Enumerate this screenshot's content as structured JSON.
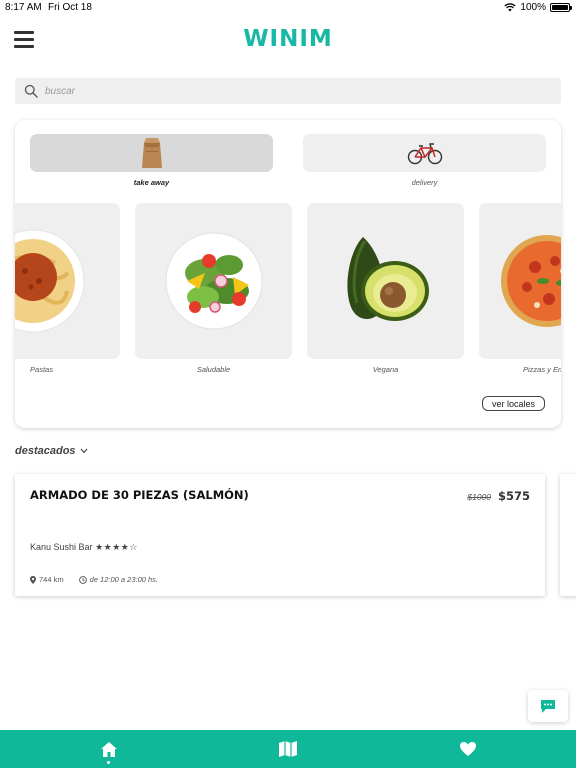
{
  "status_bar": {
    "time": "8:17 AM",
    "date": "Fri Oct 18",
    "battery": "100%"
  },
  "header": {
    "logo": "WINIM"
  },
  "search": {
    "placeholder": "buscar"
  },
  "modes": [
    {
      "label": "take away",
      "icon": "paper-bag-icon",
      "selected": true
    },
    {
      "label": "delivery",
      "icon": "bicycle-icon",
      "selected": false
    }
  ],
  "categories": [
    {
      "label": "Pastas",
      "icon": "pasta-plate-icon"
    },
    {
      "label": "Saludable",
      "icon": "salad-bowl-icon"
    },
    {
      "label": "Vegana",
      "icon": "avocado-icon"
    },
    {
      "label": "Pizzas y Em",
      "icon": "pizza-icon"
    }
  ],
  "ver_locales": "ver locales",
  "featured": {
    "title": "destacados",
    "deal": {
      "name": "ARMADO DE 30 PIEZAS (SALMÓN)",
      "old_price": "$1000",
      "price": "$575",
      "store": "Kanu Sushi Bar",
      "rating": "★★★★☆",
      "distance": "744 km",
      "hours": "de 12:00 a 23:00 hs."
    }
  },
  "colors": {
    "brand": "#17b8a6",
    "nav_bar": "#10b89a"
  },
  "bottom_nav": [
    {
      "icon": "home-icon",
      "active": true
    },
    {
      "icon": "map-icon",
      "active": false
    },
    {
      "icon": "heart-icon",
      "active": false
    }
  ]
}
